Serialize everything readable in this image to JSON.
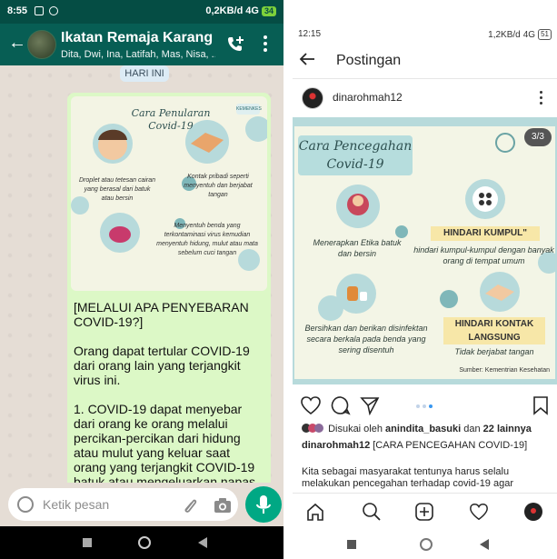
{
  "whatsapp": {
    "status": {
      "time": "8:55",
      "network": "0,2KB/d",
      "signal": "4G",
      "battery": "34"
    },
    "header": {
      "title": "Ikatan Remaja Karang I...",
      "members": "Dita, Dwi, Ina, Latifah, Mas, Nisa, ..."
    },
    "date_chip": "HARI INI",
    "image": {
      "title": "Cara Penularan Covid-19",
      "captions": [
        "Droplet atau tetesan cairan yang berasal dari batuk atau bersin",
        "Kontak pribadi seperti menyentuh dan berjabat tangan",
        "Menyentuh benda yang terkontaminasi virus kemudian menyentuh hidung, mulut atau mata sebelum cuci tangan"
      ]
    },
    "message": {
      "p1": "[MELALUI APA PENYEBARAN COVID-19?]",
      "p2": "Orang dapat tertular COVID-19 dari orang lain yang terjangkit virus ini.",
      "p3": "1. COVID-19 dapat menyebar dari orang ke orang melalui percikan-percikan dari hidung atau mulut yang keluar saat orang yang terjangkit COVID-19 batuk atau mengeluarkan napas. Orang"
    },
    "input_placeholder": "Ketik pesan",
    "colors": {
      "header": "#075e54",
      "status": "#054d44",
      "bubble": "#dcf8c6",
      "mic": "#00a884"
    }
  },
  "instagram": {
    "status": {
      "time": "12:15",
      "network": "1,2KB/d",
      "signal": "4G",
      "battery": "51"
    },
    "header_title": "Postingan",
    "username": "dinarohmah12",
    "post": {
      "counter": "3/3",
      "title": "Cara Pencegahan Covid-19",
      "items": [
        {
          "caption": "Menerapkan Etika batuk dan bersin"
        },
        {
          "heading": "HINDARI KUMPUL\"",
          "caption": "hindari kumpul-kumpul dengan banyak orang di tempat umum"
        },
        {
          "caption": "Bersihkan dan berikan disinfektan secara berkala pada benda yang sering disentuh"
        },
        {
          "heading": "HINDARI KONTAK LANGSUNG",
          "caption": "Tidak berjabat tangan"
        }
      ],
      "source": "Sumber: Kementrian Kesehatan"
    },
    "likes": {
      "prefix": "Disukai oleh ",
      "user": "anindita_basuki",
      "middle": " dan ",
      "count": "22 lainnya"
    },
    "caption_user": "dinarohmah12",
    "caption_text": " [CARA PENCEGAHAN COVID-19]",
    "body_text": "Kita sebagai masyarakat tentunya harus selalu melakukan pencegahan terhadap covid-19 agar"
  }
}
